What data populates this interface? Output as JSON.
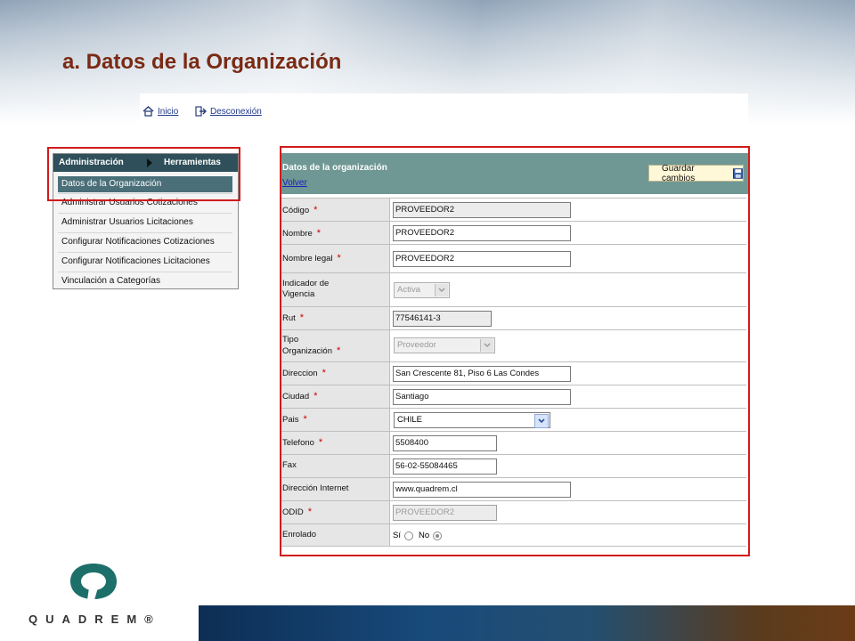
{
  "slide": {
    "title": "a. Datos de la Organización"
  },
  "topnav": {
    "home": "Inicio",
    "logout": "Desconexión"
  },
  "menu": {
    "tab_admin": "Administración",
    "tab_tools": "Herramientas",
    "selected": "Datos de la Organización",
    "items": [
      "Administrar Usuarios Cotizaciones",
      "Administrar Usuarios Licitaciones",
      "Configurar Notificaciones Cotizaciones",
      "Configurar Notificaciones Licitaciones",
      "Vinculación a Categorías"
    ]
  },
  "form": {
    "title": "Datos de la organización",
    "back": "Volver",
    "save": "Guardar cambios",
    "required_mark": "*",
    "fields": {
      "codigo": {
        "label": "Código",
        "value": "PROVEEDOR2"
      },
      "nombre": {
        "label": "Nombre",
        "value": "PROVEEDOR2"
      },
      "nombre_legal": {
        "label": "Nombre legal",
        "value": "PROVEEDOR2"
      },
      "vigencia": {
        "label1": "Indicador de",
        "label2": "Vigencia",
        "value": "Activa"
      },
      "rut": {
        "label": "Rut",
        "value": "77546141-3"
      },
      "tipo": {
        "label1": "Tipo",
        "label2": "Organización",
        "value": "Proveedor"
      },
      "direccion": {
        "label": "Direccion",
        "value": "San Crescente 81, Piso 6 Las Condes"
      },
      "ciudad": {
        "label": "Ciudad",
        "value": "Santiago"
      },
      "pais": {
        "label": "Pais",
        "value": "CHILE"
      },
      "telefono": {
        "label": "Telefono",
        "value": "5508400"
      },
      "fax": {
        "label": "Fax",
        "value": "56-02-55084465"
      },
      "internet": {
        "label": "Dirección Internet",
        "value": "www.quadrem.cl"
      },
      "odid": {
        "label": "ODID",
        "value": "PROVEEDOR2"
      },
      "enrolado": {
        "label": "Enrolado",
        "yes": "Sí",
        "no": "No",
        "selected": "No"
      }
    }
  },
  "brand": {
    "name": "QUADREM®"
  },
  "colors": {
    "title": "#7a2a14",
    "frame": "#d11b1b",
    "header": "#6f9894",
    "menu": "#2f4f5a"
  }
}
